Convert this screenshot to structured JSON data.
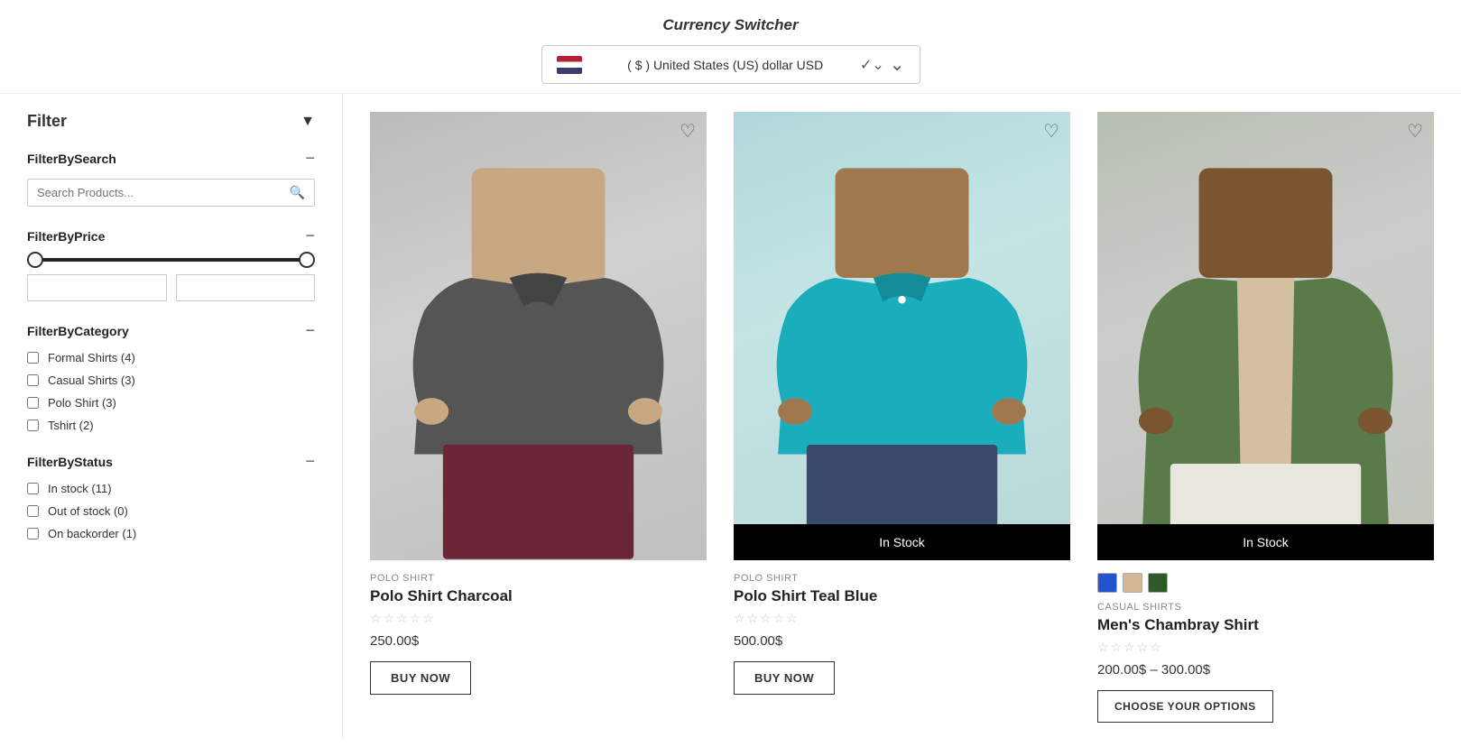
{
  "header": {
    "title": "Currency Switcher",
    "currency": {
      "label": "( $ ) United States (US) dollar USD",
      "flag": "US"
    }
  },
  "sidebar": {
    "filter_label": "Filter",
    "sections": {
      "search": {
        "label": "FilterBySearch",
        "placeholder": "Search Products..."
      },
      "price": {
        "label": "FilterByPrice",
        "min": "0",
        "max": "800"
      },
      "category": {
        "label": "FilterByCategory",
        "items": [
          {
            "label": "Formal Shirts (4)",
            "checked": false
          },
          {
            "label": "Casual Shirts (3)",
            "checked": false
          },
          {
            "label": "Polo Shirt (3)",
            "checked": false
          },
          {
            "label": "Tshirt (2)",
            "checked": false
          }
        ]
      },
      "status": {
        "label": "FilterByStatus",
        "items": [
          {
            "label": "In stock (11)",
            "checked": false
          },
          {
            "label": "Out of stock (0)",
            "checked": false
          },
          {
            "label": "On backorder (1)",
            "checked": false
          }
        ]
      }
    }
  },
  "products": [
    {
      "id": 1,
      "category": "POLO SHIRT",
      "name": "Polo Shirt Charcoal",
      "price": "250.00$",
      "price_type": "single",
      "rating": 0,
      "in_stock": false,
      "colors": [],
      "btn_label": "BUY NOW",
      "theme": "charcoal"
    },
    {
      "id": 2,
      "category": "POLO SHIRT",
      "name": "Polo Shirt Teal Blue",
      "price": "500.00$",
      "price_type": "single",
      "rating": 0,
      "in_stock": true,
      "colors": [],
      "btn_label": "BUY NOW",
      "theme": "teal"
    },
    {
      "id": 3,
      "category": "CASUAL SHIRTS",
      "name": "Men's Chambray Shirt",
      "price": "200.00$ – 300.00$",
      "price_type": "range",
      "rating": 0,
      "in_stock": true,
      "colors": [
        "#2255cc",
        "#d4b896",
        "#2d5a27"
      ],
      "btn_label": "CHOOSE YOUR OPTIONS",
      "theme": "green"
    }
  ],
  "labels": {
    "in_stock": "In Stock",
    "currency_switcher": "Currency Switcher"
  }
}
